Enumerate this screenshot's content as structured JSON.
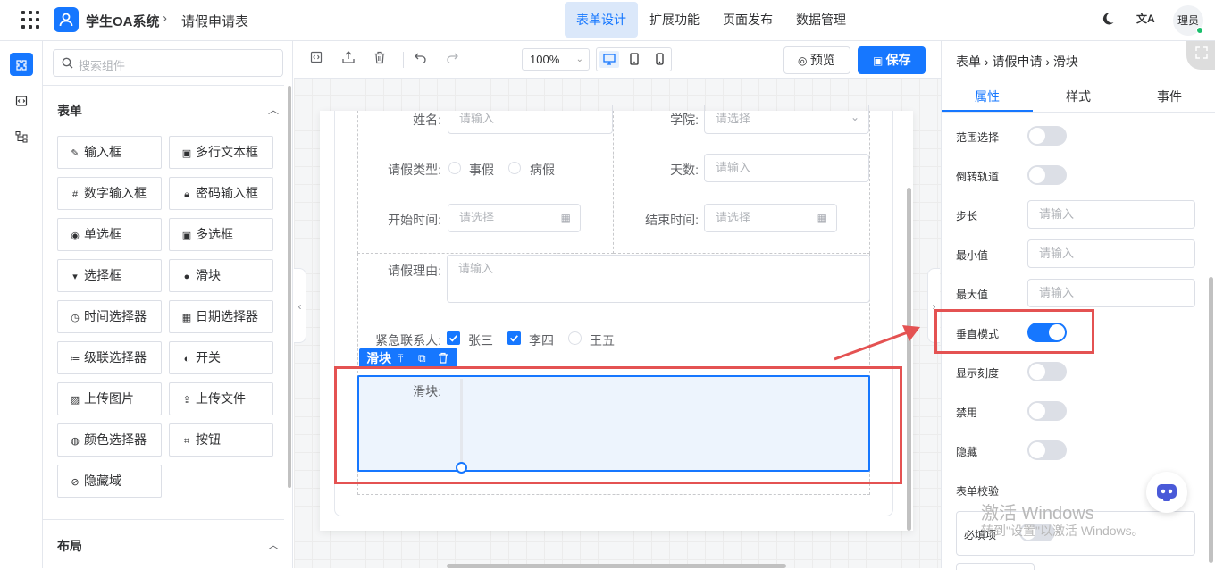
{
  "header": {
    "app_name": "学生OA系统",
    "separator": "›",
    "page_name": "请假申请表",
    "nav": [
      "表单设计",
      "扩展功能",
      "页面发布",
      "数据管理"
    ],
    "translate_icon": "文A",
    "user_name": "理员"
  },
  "components": {
    "search_placeholder": "搜索组件",
    "form_section": "表单",
    "layout_section": "布局",
    "items": [
      {
        "label": "输入框",
        "icon": "✎"
      },
      {
        "label": "多行文本框",
        "icon": "▣"
      },
      {
        "label": "数字输入框",
        "icon": "#"
      },
      {
        "label": "密码输入框",
        "icon": "🔒︎"
      },
      {
        "label": "单选框",
        "icon": "◉"
      },
      {
        "label": "多选框",
        "icon": "▣"
      },
      {
        "label": "选择框",
        "icon": "▾"
      },
      {
        "label": "滑块",
        "icon": "●"
      },
      {
        "label": "时间选择器",
        "icon": "◷"
      },
      {
        "label": "日期选择器",
        "icon": "▦"
      },
      {
        "label": "级联选择器",
        "icon": "≔"
      },
      {
        "label": "开关",
        "icon": "◐"
      },
      {
        "label": "上传图片",
        "icon": "▨"
      },
      {
        "label": "上传文件",
        "icon": "⇪"
      },
      {
        "label": "颜色选择器",
        "icon": "◍"
      },
      {
        "label": "按钮",
        "icon": "⌗"
      },
      {
        "label": "隐藏域",
        "icon": "⊘"
      }
    ]
  },
  "toolbar": {
    "zoom": "100%",
    "preview": "预览",
    "save": "保存"
  },
  "form": {
    "name_label": "姓名:",
    "name_placeholder": "请输入",
    "college_label": "学院:",
    "college_placeholder": "请选择",
    "leave_type_label": "请假类型:",
    "leave_types": [
      "事假",
      "病假"
    ],
    "days_label": "天数:",
    "days_placeholder": "请输入",
    "start_label": "开始时间:",
    "start_placeholder": "请选择",
    "end_label": "结束时间:",
    "end_placeholder": "请选择",
    "reason_label": "请假理由:",
    "reason_placeholder": "请输入",
    "contact_label": "紧急联系人:",
    "contacts": [
      {
        "name": "张三",
        "checked": true
      },
      {
        "name": "李四",
        "checked": true
      },
      {
        "name": "王五",
        "checked": false
      }
    ],
    "selected_tag": "滑块",
    "slider_label": "滑块:"
  },
  "props": {
    "breadcrumb": "表单 › 请假申请 › 滑块",
    "tabs": [
      "属性",
      "样式",
      "事件"
    ],
    "rows": [
      {
        "label": "范围选择",
        "type": "switch",
        "on": false
      },
      {
        "label": "倒转轨道",
        "type": "switch",
        "on": false
      },
      {
        "label": "步长",
        "type": "input",
        "placeholder": "请输入"
      },
      {
        "label": "最小值",
        "type": "input",
        "placeholder": "请输入"
      },
      {
        "label": "最大值",
        "type": "input",
        "placeholder": "请输入"
      },
      {
        "label": "垂直模式",
        "type": "switch",
        "on": true
      },
      {
        "label": "显示刻度",
        "type": "switch",
        "on": false
      },
      {
        "label": "禁用",
        "type": "switch",
        "on": false
      },
      {
        "label": "隐藏",
        "type": "switch",
        "on": false
      }
    ],
    "validation_label": "表单校验",
    "required_label": "必填项"
  },
  "watermark": {
    "line1": "激活 Windows",
    "line2": "转到\"设置\"以激活 Windows。"
  },
  "colors": {
    "accent": "#1677ff",
    "annotation_red": "#e45252"
  }
}
